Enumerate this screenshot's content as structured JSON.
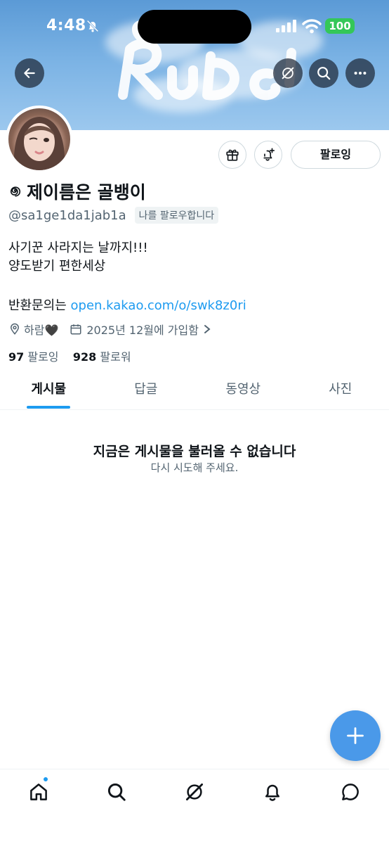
{
  "status_bar": {
    "time": "4:48",
    "battery": "100",
    "battery_color": "#34c759"
  },
  "banner": {
    "art_text": "RuDe!",
    "sky_color": "#6ea8de"
  },
  "top_nav": {
    "back_icon": "arrow-left-icon",
    "grok_icon": "grok-icon",
    "search_icon": "search-icon",
    "more_icon": "more-horizontal-icon"
  },
  "actions": {
    "gift_icon": "gift-icon",
    "subscribe_notify_icon": "bell-plus-icon",
    "follow_label": "팔로잉"
  },
  "profile": {
    "name_prefix_icon": "spiral-emoji",
    "name": "제이름은 골뱅이",
    "handle": "@sa1ge1da1jab1a",
    "follows_you_badge": "나를 팔로우합니다",
    "bio_line1": "사기꾼 사라지는 날까지!!!",
    "bio_line2": "양도받기 편한세상",
    "bio_contact_prefix": "반환문의는 ",
    "bio_contact_link": "open.kakao.com/o/swk8z0ri",
    "location": "하람🖤",
    "joined": "2025년 12월에 가입함",
    "following_count": "97",
    "following_label": "팔로잉",
    "followers_count": "928",
    "followers_label": "팔로워"
  },
  "tabs": [
    {
      "label": "게시물",
      "active": true
    },
    {
      "label": "답글",
      "active": false
    },
    {
      "label": "동영상",
      "active": false
    },
    {
      "label": "사진",
      "active": false
    }
  ],
  "empty_state": {
    "title": "지금은 게시물을 불러올 수 없습니다",
    "subtitle": "다시 시도해 주세요."
  },
  "fab": {
    "icon": "plus-icon",
    "color": "#4a99e9"
  },
  "bottom_nav": {
    "items": [
      "home-icon",
      "search-icon",
      "grok-icon",
      "notifications-icon",
      "messages-icon"
    ],
    "accent": "#1d9bf0"
  }
}
